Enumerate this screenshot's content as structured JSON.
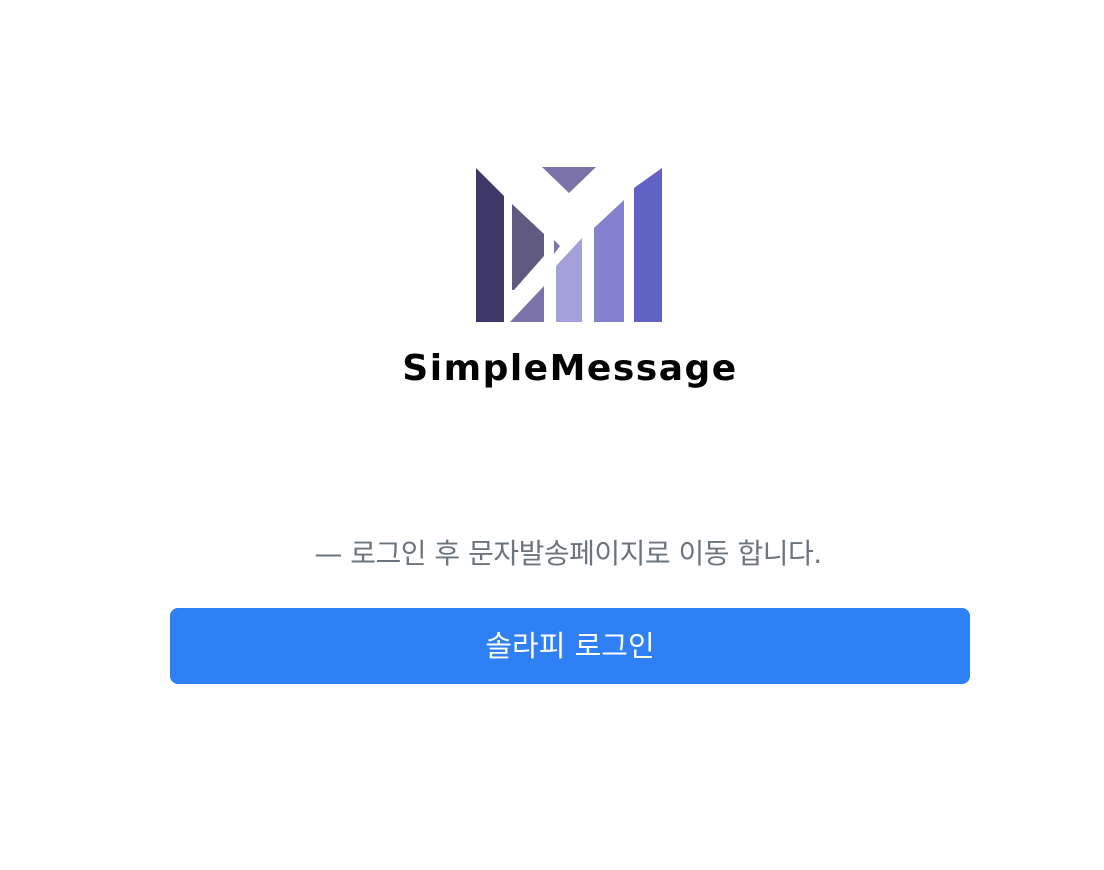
{
  "brand": {
    "logo_icon": "simplemessage-logo",
    "name": "SimpleMessage",
    "colors": [
      "#3e3867",
      "#605a80",
      "#7a72a8",
      "#a4a0d9",
      "#8481ce",
      "#6261c4"
    ]
  },
  "notice": "— 로그인 후 문자발송페이지로 이동 합니다.",
  "login_button": {
    "label": "솔라피 로그인",
    "color": "#2f80f5"
  }
}
